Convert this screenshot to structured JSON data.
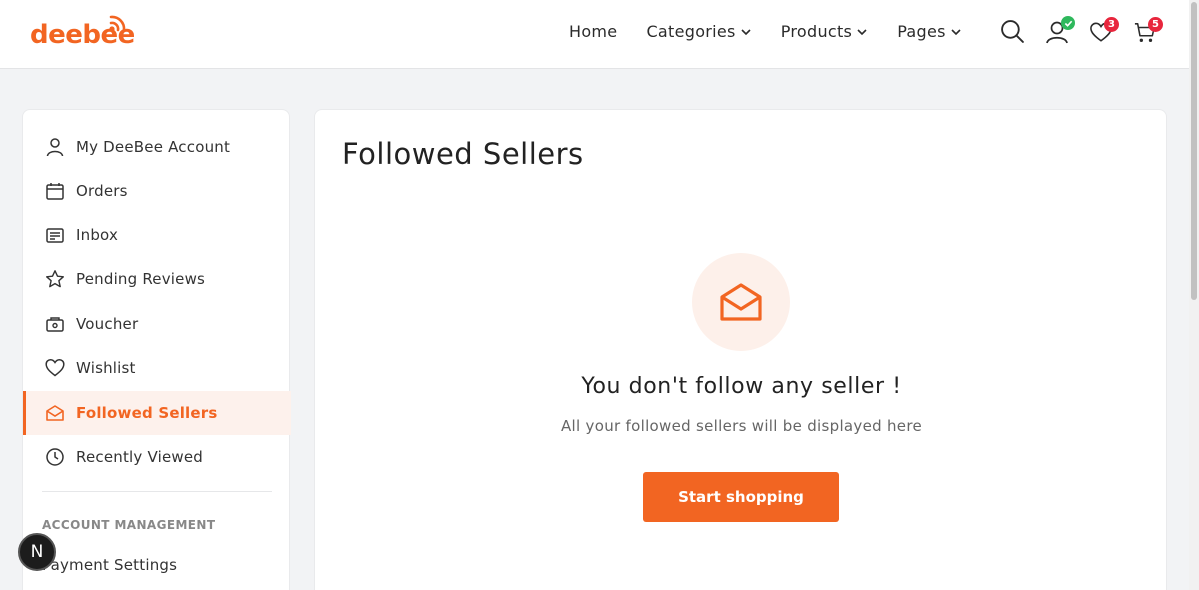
{
  "header": {
    "logo_text": "deebee",
    "nav": [
      {
        "label": "Home",
        "dropdown": false
      },
      {
        "label": "Categories",
        "dropdown": true
      },
      {
        "label": "Products",
        "dropdown": true
      },
      {
        "label": "Pages",
        "dropdown": true
      }
    ],
    "wishlist_count": "3",
    "cart_count": "5"
  },
  "sidebar": {
    "items": [
      {
        "label": "My DeeBee Account",
        "icon": "user-icon"
      },
      {
        "label": "Orders",
        "icon": "calendar-icon"
      },
      {
        "label": "Inbox",
        "icon": "inbox-icon"
      },
      {
        "label": "Pending Reviews",
        "icon": "star-icon"
      },
      {
        "label": "Voucher",
        "icon": "voucher-icon"
      },
      {
        "label": "Wishlist",
        "icon": "heart-icon"
      },
      {
        "label": "Followed Sellers",
        "icon": "envelope-icon",
        "active": true
      },
      {
        "label": "Recently Viewed",
        "icon": "clock-icon"
      }
    ],
    "section_title": "ACCOUNT MANAGEMENT",
    "section_items": [
      {
        "label": "Payment Settings"
      }
    ]
  },
  "main": {
    "title": "Followed Sellers",
    "empty_title": "You don't follow any seller !",
    "empty_subtitle": "All your followed sellers will be displayed here",
    "cta_label": "Start shopping"
  },
  "fab_label": "N",
  "colors": {
    "accent": "#f26522",
    "badge": "#e8263d",
    "verified": "#2eb85c"
  }
}
